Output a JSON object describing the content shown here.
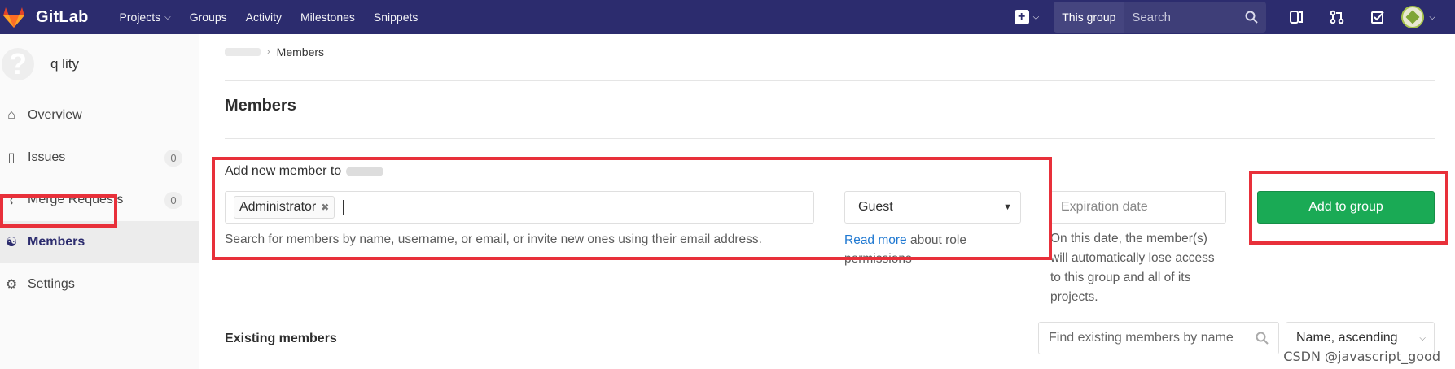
{
  "topbar": {
    "brand": "GitLab",
    "nav": [
      "Projects",
      "Groups",
      "Activity",
      "Milestones",
      "Snippets"
    ],
    "scope": "This group",
    "search_placeholder": "Search"
  },
  "sidebar": {
    "group_name": "q  lity",
    "items": [
      {
        "label": "Overview",
        "icon": "home-icon"
      },
      {
        "label": "Issues",
        "icon": "issues-icon",
        "count": "0"
      },
      {
        "label": "Merge Requests",
        "icon": "merge-request-icon",
        "count": "0"
      },
      {
        "label": "Members",
        "icon": "members-icon"
      },
      {
        "label": "Settings",
        "icon": "gear-icon"
      }
    ]
  },
  "breadcrumb": {
    "current": "Members"
  },
  "page": {
    "title": "Members",
    "add_label": "Add new member to",
    "token": "Administrator",
    "help_text": "Search for members by name, username, or email, or invite new ones using their email address.",
    "role_value": "Guest",
    "role_help_link": "Read more",
    "role_help_rest": " about role permissions",
    "expiration_placeholder": "Expiration date",
    "expiration_help": "On this date, the member(s) will automatically lose access to this group and all of its projects.",
    "add_button": "Add to group",
    "existing_label": "Existing members",
    "find_placeholder": "Find existing members by name",
    "sort_value": "Name, ascending"
  },
  "watermark": "CSDN @javascript_good",
  "colors": {
    "navbar": "#2c2c6e",
    "primary_button": "#1aaa55",
    "annotation": "#e8303a",
    "link": "#1f78d1"
  }
}
